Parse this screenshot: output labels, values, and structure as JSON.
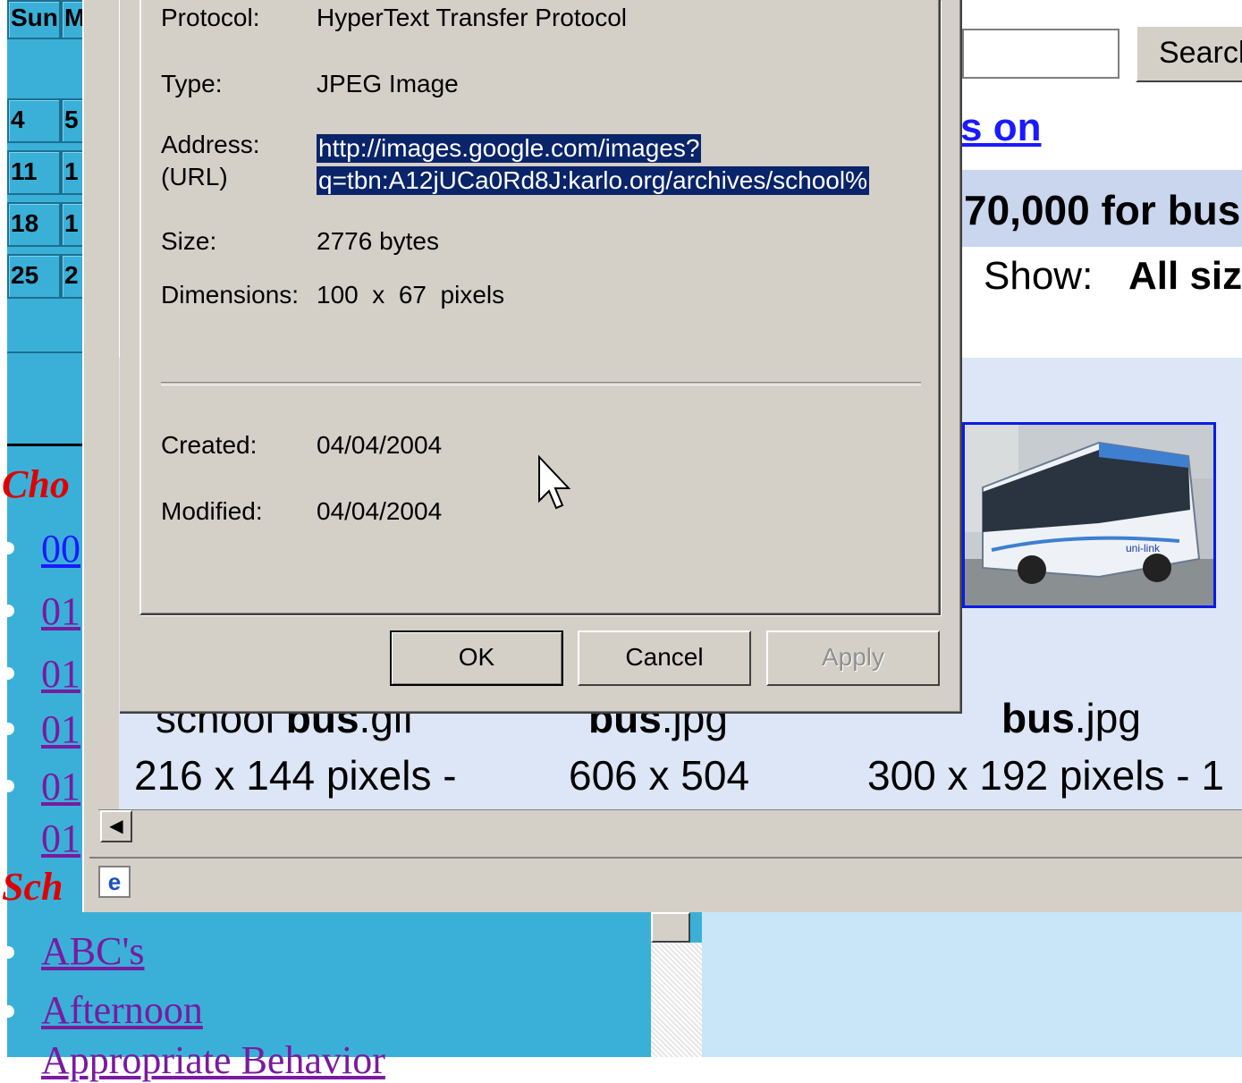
{
  "left_site": {
    "calendar": {
      "header": [
        "Sun",
        "M"
      ],
      "rows": [
        [
          "4",
          "5"
        ],
        [
          "11",
          "1"
        ],
        [
          "18",
          "1"
        ],
        [
          "25",
          "2"
        ]
      ]
    },
    "choose_heading": "Cho",
    "choose_links": [
      "00",
      "01",
      "01",
      "01",
      "01",
      "01"
    ],
    "school_heading": "Sch",
    "school_links": [
      "ABC's",
      "Afternoon",
      "Appropriate Behavior"
    ]
  },
  "browser": {
    "search_button": "Search",
    "link_fragment": "s on",
    "stats_text": "70,000 for bus",
    "show_label": "Show:",
    "show_value": "All siz",
    "results": [
      {
        "name_plain": "school ",
        "name_bold": "bus",
        "name_ext": ".gif",
        "dimensions": "216 x 144 pixels -"
      },
      {
        "name_plain": "",
        "name_bold": "bus",
        "name_ext": ".jpg",
        "dimensions": "606 x 504"
      },
      {
        "name_plain": "",
        "name_bold": "bus",
        "name_ext": ".jpg",
        "dimensions": "300 x 192 pixels - 1"
      }
    ],
    "thumbnail_text": "uni-link",
    "status_icon": "e"
  },
  "dialog": {
    "protocol_label": "Protocol:",
    "protocol_value": "HyperText Transfer Protocol",
    "type_label": "Type:",
    "type_value": "JPEG Image",
    "address_label_1": "Address:",
    "address_label_2": "(URL)",
    "address_line_1": "http://images.google.com/images?",
    "address_line_2": "q=tbn:A12jUCa0Rd8J:karlo.org/archives/school%",
    "size_label": "Size:",
    "size_value": "2776 bytes",
    "dimensions_label": "Dimensions:",
    "dimensions_value": "100  x  67  pixels",
    "created_label": "Created:",
    "created_value": "04/04/2004",
    "modified_label": "Modified:",
    "modified_value": "04/04/2004",
    "ok_label": "OK",
    "cancel_label": "Cancel",
    "apply_label": "Apply"
  },
  "colors": {
    "site_teal": "#3ab0d8",
    "heading_red": "#e00000",
    "link_purple": "#7a1aa0",
    "selection_navy": "#0a246a",
    "dialog_gray": "#d4d0c8"
  }
}
